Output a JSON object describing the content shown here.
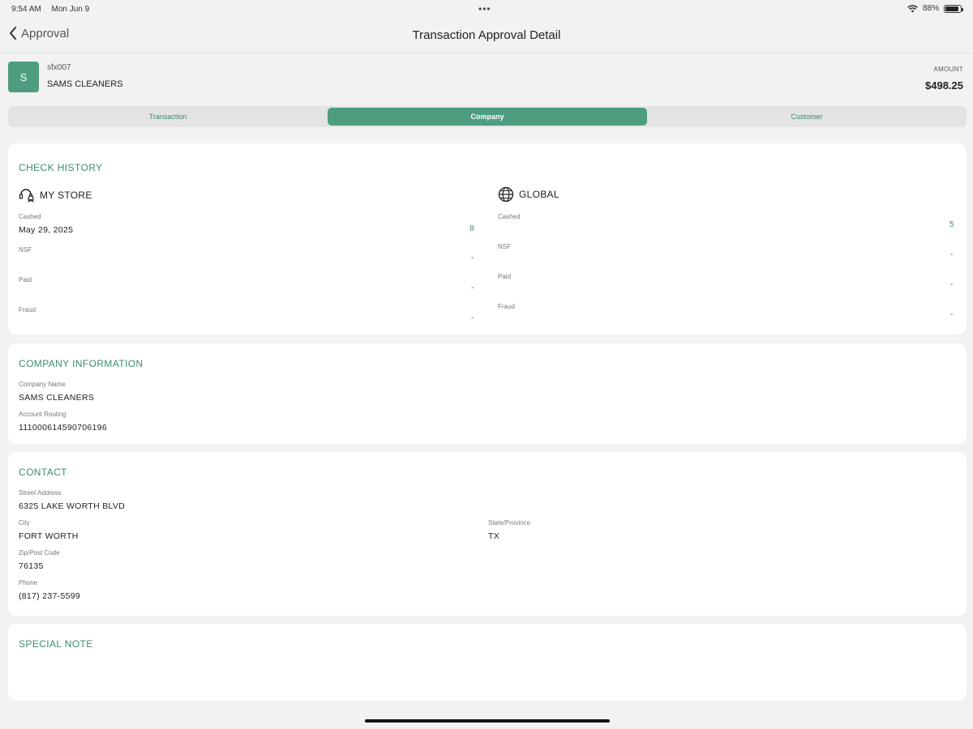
{
  "status_bar": {
    "time": "9:54 AM",
    "date": "Mon Jun 9",
    "dots": "•••",
    "battery": "88%",
    "battery_level": 0.88
  },
  "nav": {
    "back_label": "Approval",
    "title": "Transaction Approval Detail"
  },
  "merchant": {
    "initial": "S",
    "id": "sfx007",
    "name": "SAMS CLEANERS",
    "amount_label": "AMOUNT",
    "amount": "$498.25"
  },
  "tabs": [
    {
      "label": "Transaction",
      "active": false
    },
    {
      "label": "Company",
      "active": true
    },
    {
      "label": "Customer",
      "active": false
    }
  ],
  "check_history": {
    "title": "CHECK HISTORY",
    "my_store": {
      "heading": "MY STORE",
      "cashed_label": "Cashed",
      "cashed_date": "May 29, 2025",
      "cashed_count": "8",
      "nsf_label": "NSF",
      "nsf_value": "-",
      "paid_label": "Paid",
      "paid_value": "-",
      "fraud_label": "Fraud",
      "fraud_value": "-"
    },
    "global": {
      "heading": "GLOBAL",
      "cashed_label": "Cashed",
      "cashed_count": "5",
      "nsf_label": "NSF",
      "nsf_value": "-",
      "paid_label": "Paid",
      "paid_value": "-",
      "fraud_label": "Fraud",
      "fraud_value": "-"
    }
  },
  "company_info": {
    "title": "COMPANY INFORMATION",
    "name_label": "Company Name",
    "name_value": "SAMS CLEANERS",
    "account_label": "Account Routing",
    "account_value": "111000614590706196"
  },
  "contact": {
    "title": "CONTACT",
    "street_label": "Street Address",
    "street_value": "6325 LAKE WORTH BLVD",
    "city_label": "City",
    "city_value": "FORT WORTH",
    "state_label": "State/Province",
    "state_value": "TX",
    "zip_label": "Zip/Post Code",
    "zip_value": "76135",
    "phone_label": "Phone",
    "phone_value": "(817) 237-5599"
  },
  "special_note": {
    "title": "SPECIAL NOTE"
  },
  "colors": {
    "accent": "#4e9d7e",
    "accent_text": "#3d8c6e",
    "background": "#f2f2f2"
  }
}
